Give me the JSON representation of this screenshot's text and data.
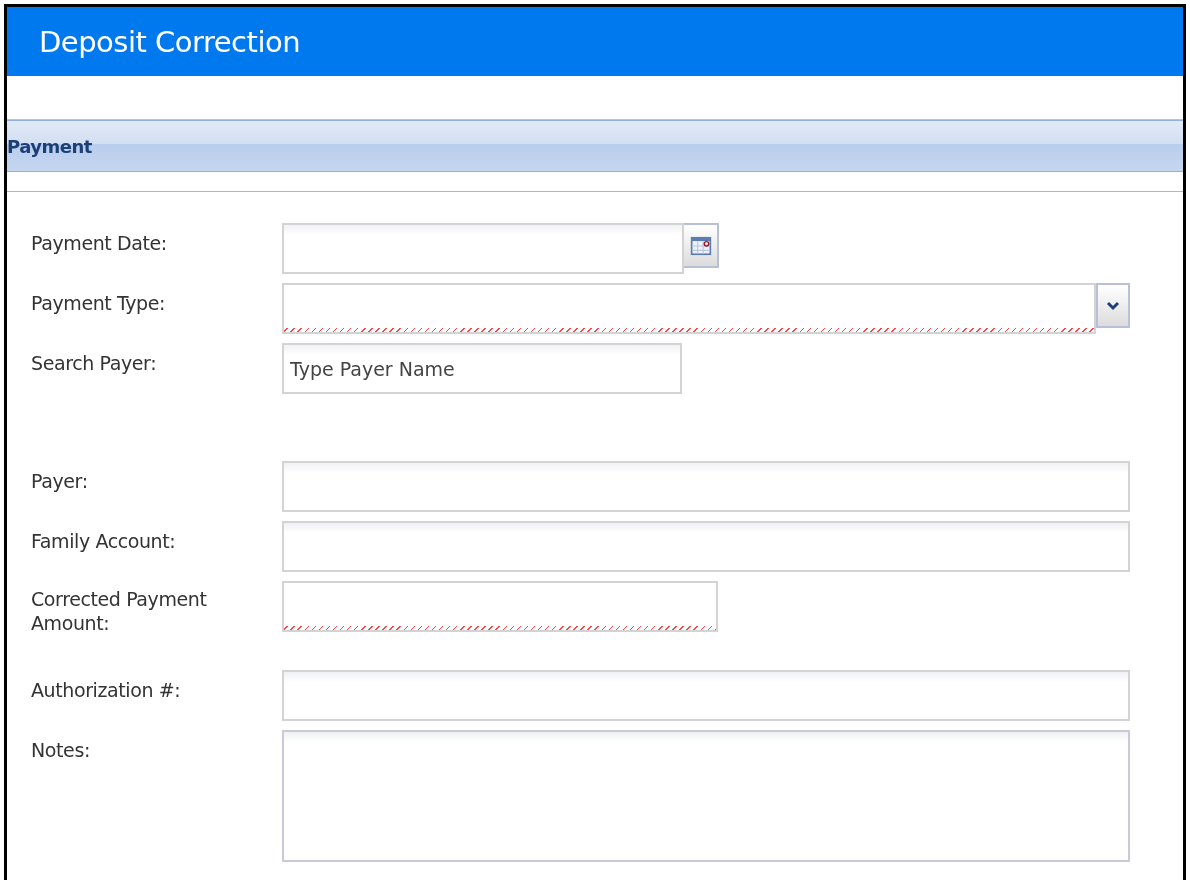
{
  "window": {
    "title": "Deposit Correction"
  },
  "section": {
    "title": "Payment"
  },
  "fields": [
    {
      "label": "Payment Date:",
      "kind": "date",
      "invalid": false
    },
    {
      "label": "Payment Type:",
      "kind": "select",
      "invalid": true
    },
    {
      "label": "Search Payer:",
      "kind": "text",
      "placeholder": "Type Payer Name",
      "invalid": false
    },
    {
      "label": "Payer:",
      "kind": "text",
      "invalid": false
    },
    {
      "label": "Family Account:",
      "kind": "text",
      "invalid": false
    },
    {
      "label": "Corrected Payment Amount:",
      "kind": "text",
      "invalid": true
    },
    {
      "label": "Authorization #:",
      "kind": "text",
      "invalid": false
    },
    {
      "label": "Notes:",
      "kind": "textarea",
      "invalid": false
    }
  ]
}
